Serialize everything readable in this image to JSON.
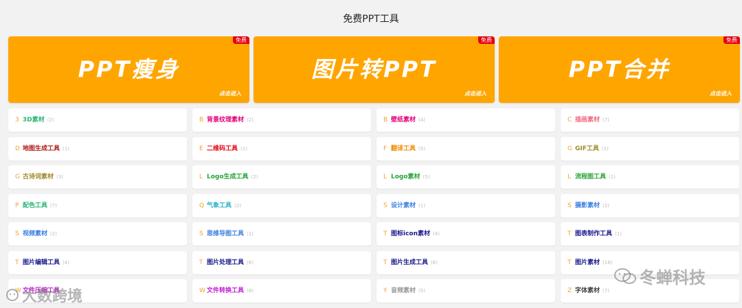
{
  "title": "免费PPT工具",
  "banners": [
    {
      "title": "PPT瘦身",
      "badge": "免费",
      "enter": "点击进入"
    },
    {
      "title": "图片转PPT",
      "badge": "免费",
      "enter": "点击进入"
    },
    {
      "title": "PPT合并",
      "badge": "免费",
      "enter": "点击进入"
    }
  ],
  "tools": [
    [
      {
        "letter": "3",
        "name": "3D素材",
        "count": "(2)",
        "color": "#2bb673"
      },
      {
        "letter": "B",
        "name": "背景纹理素材",
        "count": "(2)",
        "color": "#e6007a"
      },
      {
        "letter": "B",
        "name": "壁纸素材",
        "count": "(4)",
        "color": "#e6007a"
      },
      {
        "letter": "C",
        "name": "插画素材",
        "count": "(7)",
        "color": "#f06c84"
      }
    ],
    [
      {
        "letter": "D",
        "name": "地图生成工具",
        "count": "(1)",
        "color": "#b01a16"
      },
      {
        "letter": "E",
        "name": "二维码工具",
        "count": "(1)",
        "color": "#e60012"
      },
      {
        "letter": "F",
        "name": "翻译工具",
        "count": "(5)",
        "color": "#f08c00"
      },
      {
        "letter": "G",
        "name": "GIF工具",
        "count": "(1)",
        "color": "#a08a2a"
      }
    ],
    [
      {
        "letter": "G",
        "name": "古诗词素材",
        "count": "(3)",
        "color": "#a08a2a"
      },
      {
        "letter": "L",
        "name": "Logo生成工具",
        "count": "(2)",
        "color": "#27a337"
      },
      {
        "letter": "L",
        "name": "Logo素材",
        "count": "(5)",
        "color": "#27a337"
      },
      {
        "letter": "L",
        "name": "流程图工具",
        "count": "(1)",
        "color": "#27a337"
      }
    ],
    [
      {
        "letter": "P",
        "name": "配色工具",
        "count": "(7)",
        "color": "#2bb673"
      },
      {
        "letter": "Q",
        "name": "气象工具",
        "count": "(2)",
        "color": "#2ab4c8"
      },
      {
        "letter": "S",
        "name": "设计素材",
        "count": "(1)",
        "color": "#3d80e0"
      },
      {
        "letter": "S",
        "name": "摄影素材",
        "count": "(2)",
        "color": "#3d80e0"
      }
    ],
    [
      {
        "letter": "S",
        "name": "视频素材",
        "count": "(2)",
        "color": "#3d80e0"
      },
      {
        "letter": "S",
        "name": "思维导图工具",
        "count": "(1)",
        "color": "#3d80e0"
      },
      {
        "letter": "T",
        "name": "图标icon素材",
        "count": "(4)",
        "color": "#1a1a8c"
      },
      {
        "letter": "T",
        "name": "图表制作工具",
        "count": "(1)",
        "color": "#1a1a8c"
      }
    ],
    [
      {
        "letter": "T",
        "name": "图片编辑工具",
        "count": "(4)",
        "color": "#1a1a8c"
      },
      {
        "letter": "T",
        "name": "图片处理工具",
        "count": "(8)",
        "color": "#1a1a8c"
      },
      {
        "letter": "T",
        "name": "图片生成工具",
        "count": "(8)",
        "color": "#1a1a8c"
      },
      {
        "letter": "T",
        "name": "图片素材",
        "count": "(18)",
        "color": "#1a1a8c"
      }
    ],
    [
      {
        "letter": "W",
        "name": "文件压缩工具",
        "count": "",
        "color": "#c020d0"
      },
      {
        "letter": "W",
        "name": "文件转换工具",
        "count": "(8)",
        "color": "#c020d0"
      },
      {
        "letter": "Y",
        "name": "音频素材",
        "count": "(5)",
        "color": "#9a9a9a"
      },
      {
        "letter": "Z",
        "name": "字体素材",
        "count": "(7)",
        "color": "#444444"
      }
    ]
  ],
  "watermarks": {
    "left": "大数跨境",
    "right": "冬蝉科技"
  }
}
